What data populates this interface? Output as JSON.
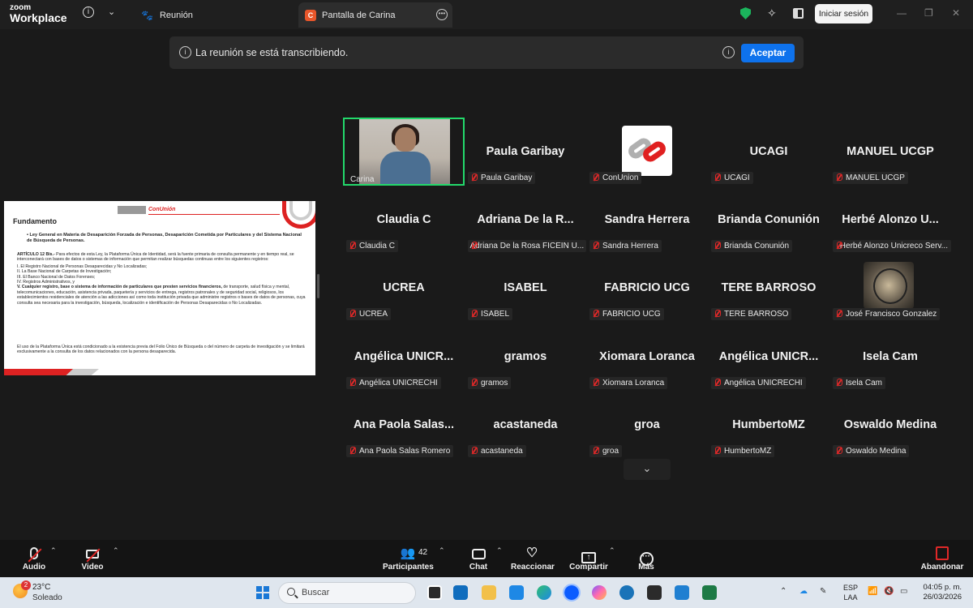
{
  "titlebar": {
    "logo_line1": "zoom",
    "logo_line2": "Workplace",
    "tabs": [
      {
        "label": "Reunión"
      },
      {
        "label": "Pantalla de Carina",
        "badge": "C"
      }
    ],
    "signin_label": "Iniciar sesión"
  },
  "banner": {
    "text": "La reunión se está transcribiendo.",
    "accept_label": "Aceptar"
  },
  "shared_screen": {
    "logo": "ConUnión",
    "title": "Fundamento",
    "law_line": "Ley General en Materia de Desaparición Forzada de Personas, Desaparición Cometida por Particulares y del Sistema Nacional de Búsqueda de Personas.",
    "article_lead": "ARTÍCULO 12 Bis.-",
    "article_text": " Para efectos de esta Ley, la Plataforma Única de Identidad, será la fuente primaria de consulta permanente y en tiempo real, se interconectará con bases de datos o sistemas de información que permitan realizar búsquedas continuas entre los siguientes registros:",
    "items": [
      "I. El Registro Nacional de Personas Desaparecidas y No Localizadas;",
      "II. La Base Nacional de Carpetas de Investigación;",
      "III. El Banco Nacional de Datos Forenses;",
      "IV. Registros Administrativos, y"
    ],
    "item_v_bold": "V. Cualquier registro, base o sistema de información de particulares que presten servicios financieros,",
    "item_v_text": " de transporte, salud física y mental, telecomunicaciones, educación, asistencia privada, paquetería y servicios de entrega, registros patronales y de seguridad social, religiosos, los establecimientos residenciales de atención a las adicciones así como toda institución privada que administre registros o bases de datos de personas, cuya consulta sea necesaria para la investigación, búsqueda, localización e identificación de Personas Desaparecidas o No Localizadas.",
    "footer": "El uso de la Plataforma Única está condicionado a la existencia previa del Folio Único de Búsqueda o del número de carpeta de investigación y se limitará exclusivamente a la consulta de los datos relacionados con la persona desaparecida."
  },
  "participants": [
    {
      "display": "",
      "label": "Carina",
      "video": true
    },
    {
      "display": "Paula Garibay",
      "label": "Paula Garibay"
    },
    {
      "display": "",
      "label": "ConUnion",
      "avatar": "conunion-logo"
    },
    {
      "display": "UCAGI",
      "label": "UCAGI"
    },
    {
      "display": "MANUEL UCGP",
      "label": "MANUEL UCGP"
    },
    {
      "display": "Claudia C",
      "label": "Claudia C"
    },
    {
      "display": "Adriana De la R...",
      "label": "Adriana De la Rosa FICEIN U..."
    },
    {
      "display": "Sandra Herrera",
      "label": "Sandra Herrera"
    },
    {
      "display": "Brianda Conunión",
      "label": "Brianda Conunión"
    },
    {
      "display": "Herbé Alonzo U...",
      "label": "Herbé Alonzo Unicreco Serv..."
    },
    {
      "display": "UCREA",
      "label": "UCREA"
    },
    {
      "display": "ISABEL",
      "label": "ISABEL"
    },
    {
      "display": "FABRICIO UCG",
      "label": "FABRICIO UCG"
    },
    {
      "display": "TERE BARROSO",
      "label": "TERE BARROSO"
    },
    {
      "display": "",
      "label": "José Francisco Gonzalez",
      "avatar": "tree-image"
    },
    {
      "display": "Angélica  UNICR...",
      "label": "Angélica UNICRECHI"
    },
    {
      "display": "gramos",
      "label": "gramos"
    },
    {
      "display": "Xiomara Loranca",
      "label": "Xiomara Loranca"
    },
    {
      "display": "Angélica  UNICR...",
      "label": "Angélica UNICRECHI"
    },
    {
      "display": "Isela Cam",
      "label": "Isela Cam"
    },
    {
      "display": "Ana Paola Salas...",
      "label": "Ana Paola Salas Romero"
    },
    {
      "display": "acastaneda",
      "label": "acastaneda"
    },
    {
      "display": "groa",
      "label": "groa"
    },
    {
      "display": "HumbertoMZ",
      "label": "HumbertoMZ"
    },
    {
      "display": "Oswaldo Medina",
      "label": "Oswaldo Medina"
    }
  ],
  "toolbar": {
    "audio": "Audio",
    "video": "Video",
    "participants": "Participantes",
    "participant_count": "42",
    "chat": "Chat",
    "react": "Reaccionar",
    "share": "Compartir",
    "more": "Más",
    "leave": "Abandonar"
  },
  "taskbar": {
    "weather_temp": "23°C",
    "weather_cond": "Soleado",
    "weather_badge": "2",
    "search_placeholder": "Buscar",
    "lang_line1": "ESP",
    "lang_line2": "LAA",
    "time": "04:05 p. m.",
    "date": "26/03/2026"
  },
  "colors": {
    "accent": "#0e72ed",
    "active_speaker": "#23d96b",
    "muted": "#e02828",
    "brand_red": "#dd2222"
  }
}
